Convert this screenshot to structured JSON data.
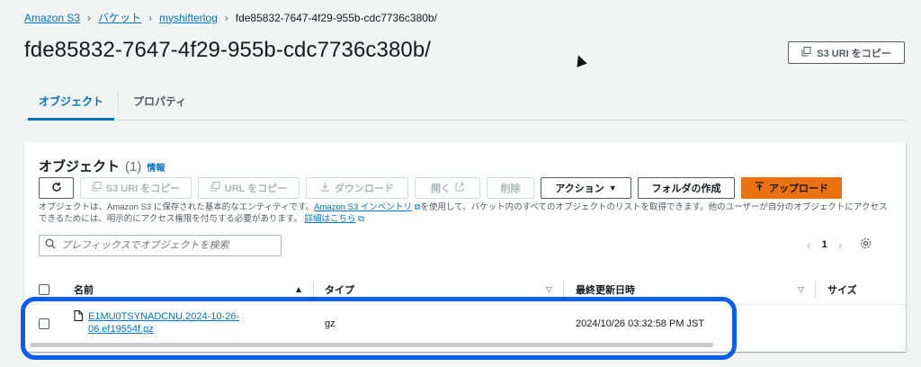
{
  "breadcrumb": {
    "items": [
      "Amazon S3",
      "バケット",
      "myshifterlog"
    ],
    "current": "fde85832-7647-4f29-955b-cdc7736c380b/"
  },
  "page": {
    "title": "fde85832-7647-4f29-955b-cdc7736c380b/"
  },
  "header_actions": {
    "copy_uri": "S3 URI をコピー"
  },
  "tabs": [
    {
      "label": "オブジェクト",
      "active": true
    },
    {
      "label": "プロパティ",
      "active": false
    }
  ],
  "objects_panel": {
    "title": "オブジェクト",
    "count": "(1)",
    "info": "情報",
    "toolbar": {
      "copy_s3_uri": "S3 URI をコピー",
      "copy_url": "URL をコピー",
      "download": "ダウンロード",
      "open": "開く",
      "delete": "削除",
      "actions": "アクション",
      "create_folder": "フォルダの作成",
      "upload": "アップロード"
    },
    "description_before": "オブジェクトは、Amazon S3 に保存された基本的なエンティティです。",
    "inventory_link": "Amazon S3 インベントリ",
    "description_middle": "を使用して、バケット内のすべてのオブジェクトのリストを取得できます。他のユーザーが自分のオブジェクトにアクセスできるためには、明示的にアクセス権限を付与する必要があります。",
    "details_link": "詳細はこちら",
    "search_placeholder": "プレフィックスでオブジェクトを検索",
    "pagination": {
      "page": "1"
    }
  },
  "table": {
    "columns": [
      "名前",
      "タイプ",
      "最終更新日時",
      "サイズ"
    ],
    "rows": [
      {
        "name_line1": "E1MU0TSYNADCNU.2024-10-26-",
        "name_line2": "06.ef19554f.gz",
        "type": "gz",
        "last_modified": "2024/10/26 03:32:58 PM JST",
        "size": ""
      }
    ]
  },
  "colors": {
    "link": "#0073bb",
    "primary": "#ec7211",
    "highlight": "#0a5cf5"
  }
}
